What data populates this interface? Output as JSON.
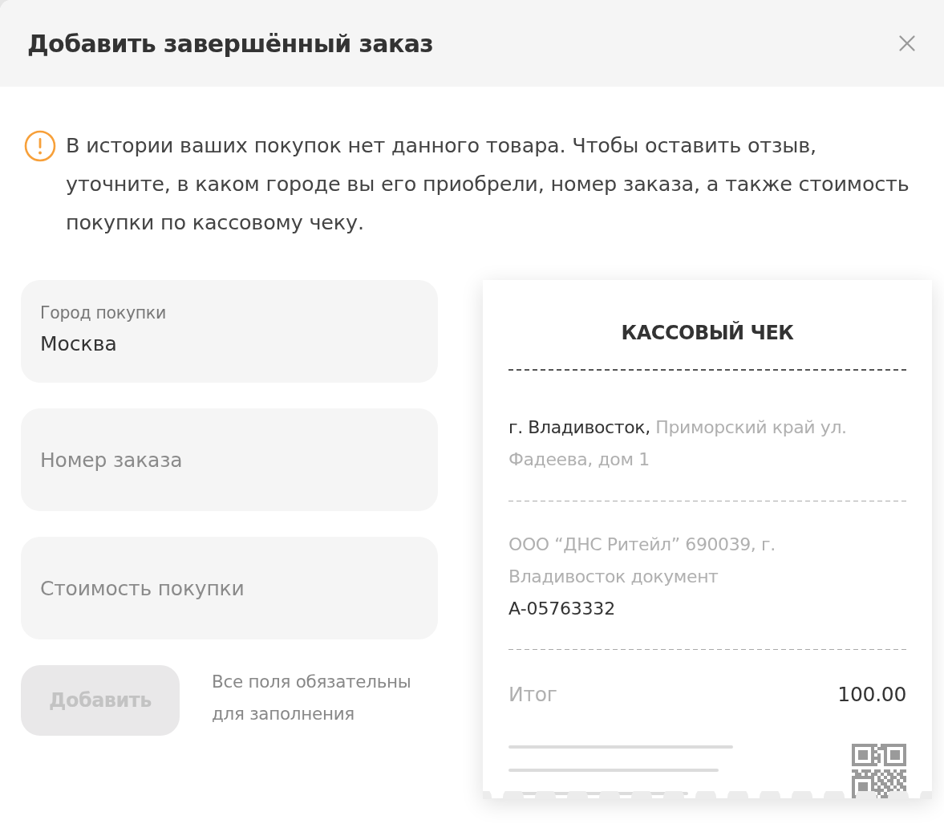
{
  "dialog": {
    "title": "Добавить завершённый заказ"
  },
  "notice": {
    "text": "В истории ваших покупок нет данного товара. Чтобы оставить отзыв, уточните, в каком городе вы его приобрели, номер заказа, а также стоимость покупки по кассовому чеку."
  },
  "fields": [
    {
      "kind": "floating",
      "label": "Город покупки",
      "value": "Москва"
    },
    {
      "kind": "plain",
      "placeholder": "Номер заказа"
    },
    {
      "kind": "plain",
      "placeholder": "Стоимость покупки"
    }
  ],
  "submit": {
    "label": "Добавить",
    "disabled": true
  },
  "hint": "Все поля обязательны для заполнения",
  "receipt": {
    "title": "КАССОВЫЙ ЧЕК",
    "address": "**г. Владивосток,** Приморский край ул. Фадеева, дом 1",
    "company": "ООО “ДНС Ритейл” 690039, г. Владивосток документ",
    "document_number": "А-05763332",
    "total_label": "Итог",
    "total_value": "100.00"
  }
}
